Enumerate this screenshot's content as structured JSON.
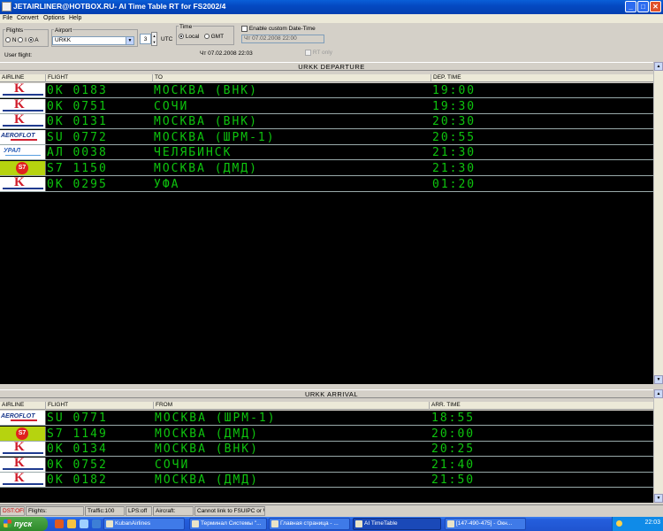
{
  "window": {
    "title": "JETAIRLINER@HOTBOX.RU- AI Time Table RT for FS2002/4",
    "minimize": "_",
    "maximize": "□",
    "close": "✕"
  },
  "menu": [
    "File",
    "Convert",
    "Options",
    "Help"
  ],
  "controls": {
    "flights_label": "Flights",
    "flights_options": [
      "N",
      "I",
      "A"
    ],
    "flights_selected": "A",
    "airport_label": "Airport",
    "airport_value": "URKK",
    "utc_offset": "3",
    "utc_label": "UTC",
    "time_label": "Time",
    "time_options": [
      "Local",
      "GMT"
    ],
    "time_selected": "Local",
    "current_datetime": "Чт 07.02.2008 22:03",
    "custom_date_label": "Enable custom Date-Time",
    "custom_date_value": "Чт 07.02.2008 22:00",
    "rt_only_label": "RT only",
    "user_flight_label": "User flight:"
  },
  "departure": {
    "title": "URKK DEPARTURE",
    "columns": [
      "AIRLINE",
      "FLIGHT",
      "TO",
      "DEP. TIME"
    ],
    "rows": [
      {
        "logo": "kuban-airlines-logo",
        "flight": "0K 0183",
        "dest": "МОСКВА (ВНК)",
        "time": "19:00"
      },
      {
        "logo": "kuban-airlines-logo",
        "flight": "0K 0751",
        "dest": "СОЧИ",
        "time": "19:30"
      },
      {
        "logo": "kuban-airlines-logo",
        "flight": "0K 0131",
        "dest": "МОСКВА (ВНК)",
        "time": "20:30"
      },
      {
        "logo": "aeroflot-logo",
        "flight": "SU 0772",
        "dest": "МОСКВА (ШРМ-1)",
        "time": "20:55"
      },
      {
        "logo": "ural-airlines-logo",
        "flight": "АЛ 0038",
        "dest": "ЧЕЛЯБИНСК",
        "time": "21:30"
      },
      {
        "logo": "s7-logo",
        "flight": "S7 1150",
        "dest": "МОСКВА (ДМД)",
        "time": "21:30"
      },
      {
        "logo": "kuban-airlines-logo",
        "flight": "0K 0295",
        "dest": "УФА",
        "time": "01:20"
      }
    ]
  },
  "arrival": {
    "title": "URKK ARRIVAL",
    "columns": [
      "AIRLINE",
      "FLIGHT",
      "FROM",
      "ARR. TIME"
    ],
    "rows": [
      {
        "logo": "aeroflot-logo",
        "flight": "SU 0771",
        "dest": "МОСКВА (ШРМ-1)",
        "time": "18:55"
      },
      {
        "logo": "s7-logo",
        "flight": "S7 1149",
        "dest": "МОСКВА (ДМД)",
        "time": "20:00"
      },
      {
        "logo": "kuban-airlines-logo",
        "flight": "0K 0134",
        "dest": "МОСКВА (ВНК)",
        "time": "20:25"
      },
      {
        "logo": "kuban-airlines-logo",
        "flight": "0K 0752",
        "dest": "СОЧИ",
        "time": "21:40"
      },
      {
        "logo": "kuban-airlines-logo",
        "flight": "0K 0182",
        "dest": "МОСКВА (ДМД)",
        "time": "21:50"
      }
    ]
  },
  "logo_text": {
    "aeroflot": "AEROFLOT",
    "ural": "УРАЛ",
    "s7": "S7",
    "kuban": "K"
  },
  "status": [
    "DST:OFF",
    "Flights:",
    "Traffic:100",
    "LPS:off",
    "Aircraft:",
    "Cannot link to FSUIPC or W"
  ],
  "taskbar": {
    "start": "пуск",
    "tasks": [
      {
        "label": "KubanAirlines",
        "active": false
      },
      {
        "label": "Терминал Системы \"...",
        "active": false
      },
      {
        "label": "Главная страница - ...",
        "active": false
      },
      {
        "label": "AI TimeTable",
        "active": true
      },
      {
        "label": "[147-490-475] - Окн...",
        "active": false
      }
    ],
    "clock": "22:03"
  },
  "colors": {
    "led": "#0ec40e",
    "board_bg": "#000000",
    "titlebar": "#0449c2"
  }
}
